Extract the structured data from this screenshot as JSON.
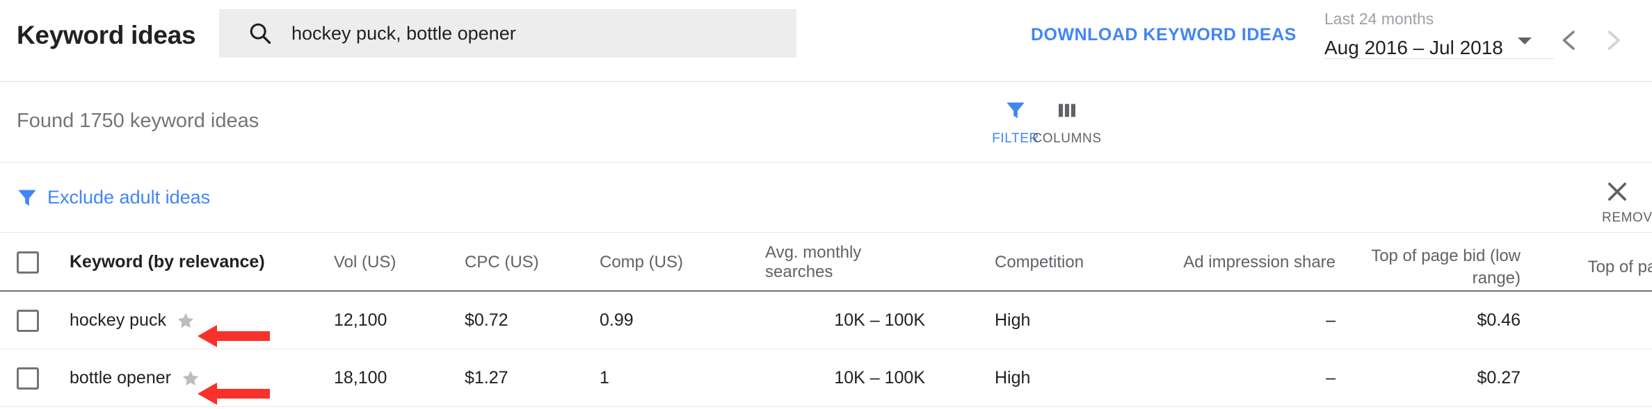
{
  "header": {
    "title": "Keyword ideas",
    "search": {
      "icon": "search-icon",
      "value": "hockey puck, bottle opener"
    },
    "download_label": "DOWNLOAD KEYWORD IDEAS",
    "date_range": {
      "preset_label": "Last 24 months",
      "value": "Aug 2016 – Jul 2018",
      "caret_icon": "chevron-down-icon",
      "prev_icon": "chevron-left-icon",
      "next_icon": "chevron-right-icon"
    }
  },
  "results_bar": {
    "found_text": "Found 1750 keyword ideas",
    "filter": {
      "label": "FILTER",
      "icon": "funnel-icon"
    },
    "columns": {
      "label": "COLUMNS",
      "icon": "columns-icon"
    }
  },
  "applied_filter": {
    "icon": "funnel-icon",
    "label": "Exclude adult ideas",
    "remove": {
      "label": "REMOVE",
      "icon": "close-icon"
    }
  },
  "table": {
    "columns": [
      {
        "label": "Keyword (by relevance)"
      },
      {
        "label": "Vol (US)"
      },
      {
        "label": "CPC (US)"
      },
      {
        "label": "Comp (US)"
      },
      {
        "label": "Avg. monthly searches"
      },
      {
        "label": "Competition"
      },
      {
        "label": "Ad impression share"
      },
      {
        "label": "Top of page bid (low range)"
      },
      {
        "label": "Top of pa (high r"
      }
    ],
    "rows": [
      {
        "keyword": "hockey puck",
        "vol": "12,100",
        "cpc": "$0.72",
        "comp": "0.99",
        "avg_monthly_searches": "10K – 100K",
        "competition": "High",
        "ad_impression_share": "–",
        "top_bid_low": "$0.46",
        "top_bid_high": ""
      },
      {
        "keyword": "bottle opener",
        "vol": "18,100",
        "cpc": "$1.27",
        "comp": "1",
        "avg_monthly_searches": "10K – 100K",
        "competition": "High",
        "ad_impression_share": "–",
        "top_bid_low": "$0.27",
        "top_bid_high": ""
      }
    ]
  },
  "colors": {
    "accent_blue": "#4285f4",
    "annotation_red": "#f8312a",
    "text_primary": "#202124",
    "text_secondary": "#5f6368",
    "search_bg": "#ededed"
  }
}
